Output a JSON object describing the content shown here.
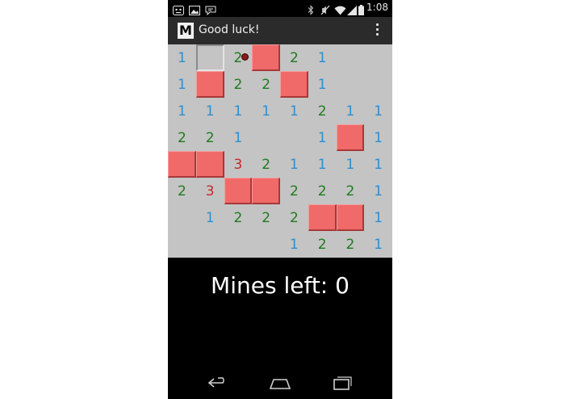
{
  "status_bar": {
    "time": "1:08",
    "left_icons": [
      "notification-icon",
      "image-icon",
      "chat-icon"
    ],
    "right_icons": [
      "bluetooth-icon",
      "mute-icon",
      "wifi-icon",
      "signal-icon",
      "battery-icon"
    ]
  },
  "action_bar": {
    "logo_letter": "M",
    "title": "Good luck!"
  },
  "board": {
    "cols": 8,
    "rows": 8,
    "colors": {
      "1": "#2e8ece",
      "2": "#1f7a1f",
      "3": "#c62828"
    },
    "cells": [
      [
        "1",
        "H",
        "2*",
        "F",
        "2",
        "1",
        "",
        ""
      ],
      [
        "1",
        "F",
        "2",
        "2",
        "F",
        "1",
        "",
        ""
      ],
      [
        "1",
        "1",
        "1",
        "1",
        "1",
        "2",
        "1",
        "1"
      ],
      [
        "2",
        "2",
        "1",
        "",
        "",
        "1",
        "F",
        "1"
      ],
      [
        "F",
        "F",
        "3",
        "2",
        "1",
        "1",
        "1",
        "1"
      ],
      [
        "2",
        "3",
        "F",
        "F",
        "2",
        "2",
        "2",
        "1"
      ],
      [
        "",
        "1",
        "2",
        "2",
        "2",
        "F",
        "F",
        "1"
      ],
      [
        "",
        "",
        "",
        "",
        "1",
        "2",
        "2",
        "1"
      ]
    ]
  },
  "footer": {
    "mines_left": "Mines left: 0"
  },
  "nav_bar": {
    "buttons": [
      "back-icon",
      "home-icon",
      "recent-apps-icon"
    ]
  }
}
